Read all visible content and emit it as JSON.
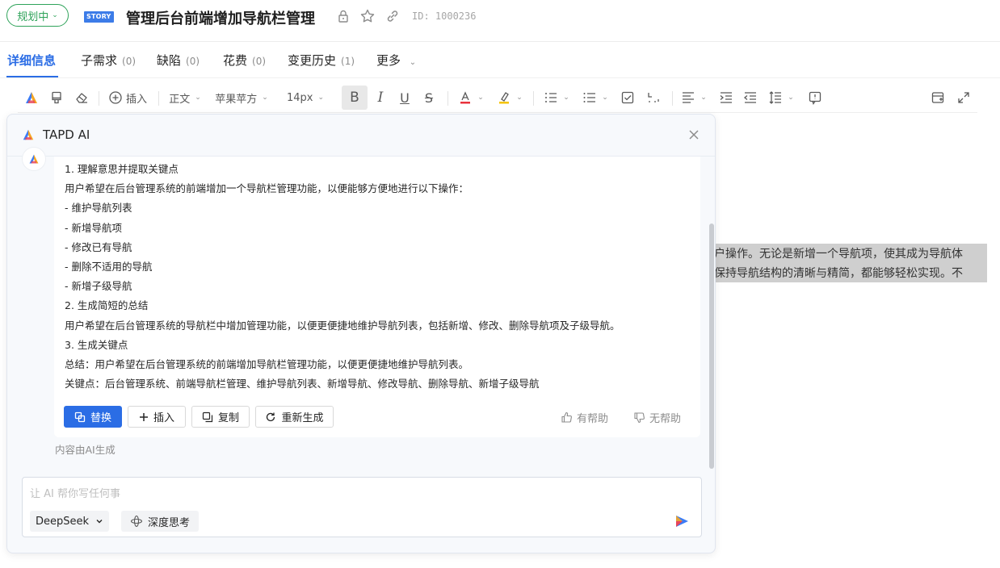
{
  "header": {
    "status": "规划中",
    "type_badge": "STORY",
    "title": "管理后台前端增加导航栏管理",
    "id_label": "ID: 1000236"
  },
  "tabs": [
    {
      "label": "详细信息",
      "count": ""
    },
    {
      "label": "子需求",
      "count": "(0)"
    },
    {
      "label": "缺陷",
      "count": "(0)"
    },
    {
      "label": "花费",
      "count": "(0)"
    },
    {
      "label": "变更历史",
      "count": "(1)"
    },
    {
      "label": "更多",
      "count": ""
    }
  ],
  "toolbar": {
    "insert": "插入",
    "paragraph": "正文",
    "font": "苹果苹方",
    "size": "14px"
  },
  "background_text": {
    "line1": "户操作。无论是新增一个导航项，使其成为导航体",
    "line2": "保持导航结构的清晰与精简，都能够轻松实现。不"
  },
  "ai_panel": {
    "title": "TAPD AI",
    "response_lines": [
      "1. 理解意思并提取关键点",
      "用户希望在后台管理系统的前端增加一个导航栏管理功能，以便能够方便地进行以下操作：",
      "- 维护导航列表",
      "- 新增导航项",
      "- 修改已有导航",
      "- 删除不适用的导航",
      "- 新增子级导航",
      "2. 生成简短的总结",
      "用户希望在后台管理系统的导航栏中增加管理功能，以便更便捷地维护导航列表，包括新增、修改、删除导航项及子级导航。",
      "3. 生成关键点",
      "总结：用户希望在后台管理系统的前端增加导航栏管理功能，以便更便捷地维护导航列表。",
      "关键点：后台管理系统、前端导航栏管理、维护导航列表、新增导航、修改导航、删除导航、新增子级导航"
    ],
    "buttons": {
      "replace": "替换",
      "insert": "插入",
      "copy": "复制",
      "regenerate": "重新生成"
    },
    "feedback": {
      "helpful": "有帮助",
      "unhelpful": "无帮助"
    },
    "note": "内容由AI生成",
    "input_placeholder": "让 AI 帮你写任何事",
    "model": "DeepSeek",
    "deep_think": "深度思考"
  },
  "colors": {
    "accent": "#2b6de5",
    "status_green": "#2fa35a"
  }
}
